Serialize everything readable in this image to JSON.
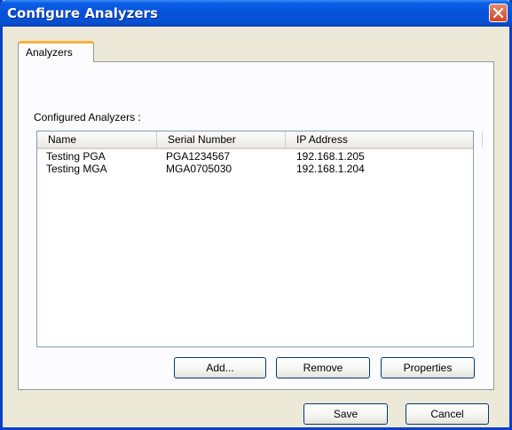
{
  "window": {
    "title": "Configure Analyzers",
    "close_icon": "close-icon"
  },
  "tabs": [
    {
      "label": "Analyzers",
      "selected": true
    }
  ],
  "panel": {
    "section_label": "Configured Analyzers :",
    "columns": [
      "Name",
      "Serial Number",
      "IP Address"
    ],
    "rows": [
      {
        "name": "Testing PGA",
        "serial": "PGA1234567",
        "ip": "192.168.1.205"
      },
      {
        "name": "Testing MGA",
        "serial": "MGA0705030",
        "ip": "192.168.1.204"
      }
    ],
    "buttons": {
      "add": "Add...",
      "remove": "Remove",
      "properties": "Properties"
    }
  },
  "footer": {
    "save": "Save",
    "cancel": "Cancel"
  },
  "colors": {
    "titlebar": "#0653d8",
    "face": "#ece9d8",
    "tab_accent": "#f7b33d",
    "close_button": "#d2451f"
  }
}
